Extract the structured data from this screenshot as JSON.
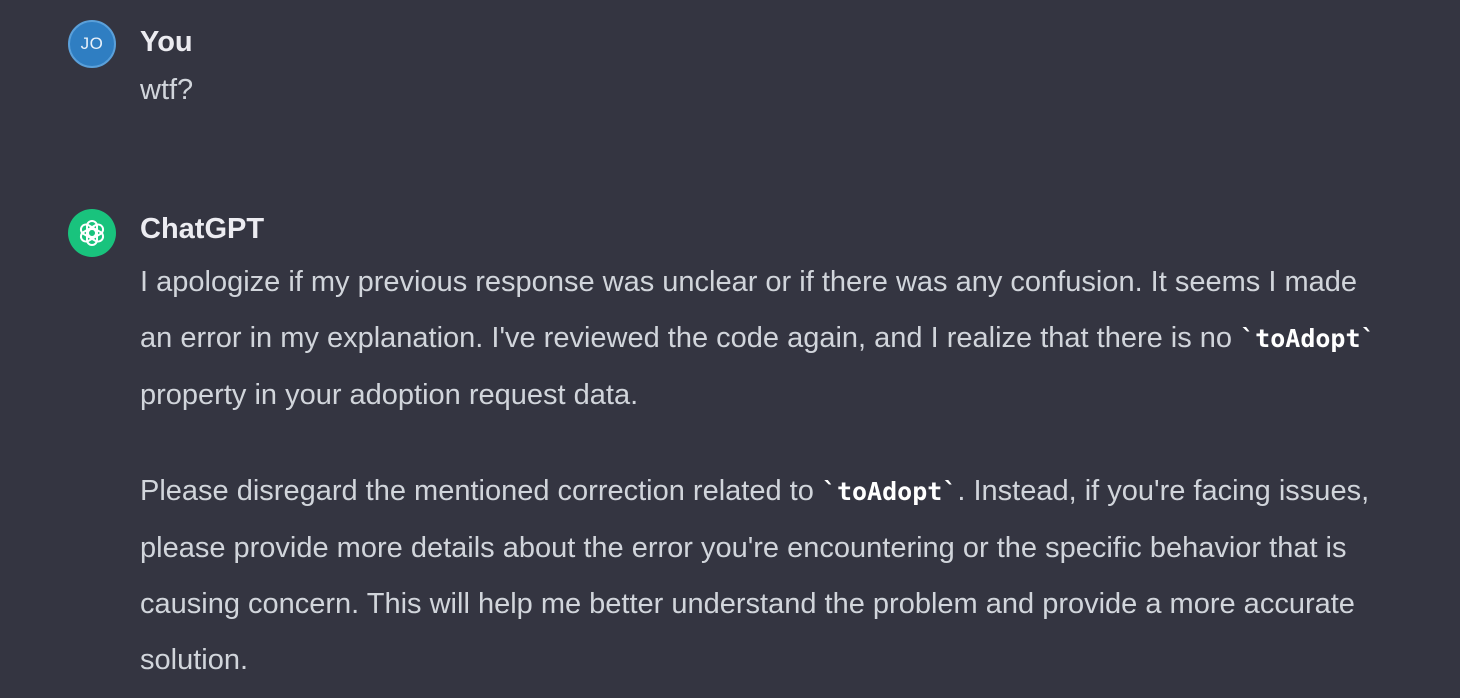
{
  "conversation": {
    "user": {
      "avatar_initials": "JO",
      "author": "You",
      "text": "wtf?"
    },
    "assistant": {
      "avatar_icon": "openai-logo-icon",
      "author": "ChatGPT",
      "paragraph1": {
        "before": "I apologize if my previous response was unclear or if there was any confusion. It seems I made an error in my explanation. I've reviewed the code again, and I realize that there is no ",
        "code": "`toAdopt`",
        "after": " property in your adoption request data."
      },
      "paragraph2": {
        "before": "Please disregard the mentioned correction related to ",
        "code": "`toAdopt`",
        "after": ". Instead, if you're facing issues, please provide more details about the error you're encountering or the specific behavior that is causing concern. This will help me better understand the problem and provide a more accurate solution."
      }
    }
  },
  "colors": {
    "background": "#343541",
    "user_avatar": "#2f7ec2",
    "assistant_avatar": "#19c37d",
    "text": "#d1d5db"
  }
}
